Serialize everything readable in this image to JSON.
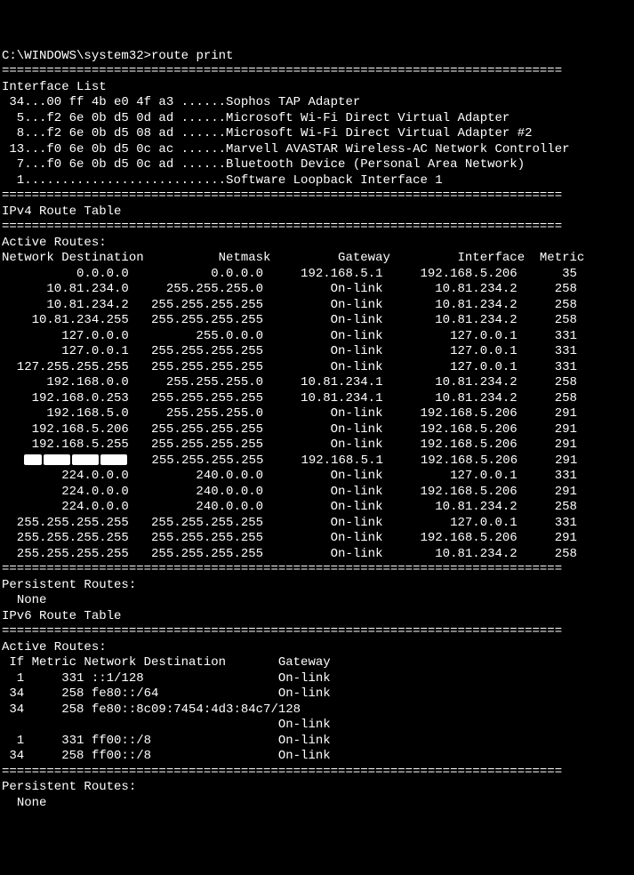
{
  "prompt": "C:\\WINDOWS\\system32>",
  "command": "route print",
  "divider": "===========================================================================",
  "interface_list": {
    "title": "Interface List",
    "items": [
      {
        "idx": "34",
        "mac": "00 ff 4b e0 4f a3",
        "desc": "Sophos TAP Adapter"
      },
      {
        "idx": "5",
        "mac": "f2 6e 0b d5 0d ad",
        "desc": "Microsoft Wi-Fi Direct Virtual Adapter"
      },
      {
        "idx": "8",
        "mac": "f2 6e 0b d5 08 ad",
        "desc": "Microsoft Wi-Fi Direct Virtual Adapter #2"
      },
      {
        "idx": "13",
        "mac": "f0 6e 0b d5 0c ac",
        "desc": "Marvell AVASTAR Wireless-AC Network Controller"
      },
      {
        "idx": "7",
        "mac": "f0 6e 0b d5 0c ad",
        "desc": "Bluetooth Device (Personal Area Network)"
      },
      {
        "idx": "1",
        "mac": "",
        "desc": "Software Loopback Interface 1"
      }
    ]
  },
  "ipv4": {
    "title": "IPv4 Route Table",
    "active_routes_label": "Active Routes:",
    "headers": [
      "Network Destination",
      "Netmask",
      "Gateway",
      "Interface",
      "Metric"
    ],
    "routes": [
      {
        "dest": "0.0.0.0",
        "mask": "0.0.0.0",
        "gw": "192.168.5.1",
        "iface": "192.168.5.206",
        "metric": "35"
      },
      {
        "dest": "10.81.234.0",
        "mask": "255.255.255.0",
        "gw": "On-link",
        "iface": "10.81.234.2",
        "metric": "258"
      },
      {
        "dest": "10.81.234.2",
        "mask": "255.255.255.255",
        "gw": "On-link",
        "iface": "10.81.234.2",
        "metric": "258"
      },
      {
        "dest": "10.81.234.255",
        "mask": "255.255.255.255",
        "gw": "On-link",
        "iface": "10.81.234.2",
        "metric": "258"
      },
      {
        "dest": "127.0.0.0",
        "mask": "255.0.0.0",
        "gw": "On-link",
        "iface": "127.0.0.1",
        "metric": "331"
      },
      {
        "dest": "127.0.0.1",
        "mask": "255.255.255.255",
        "gw": "On-link",
        "iface": "127.0.0.1",
        "metric": "331"
      },
      {
        "dest": "127.255.255.255",
        "mask": "255.255.255.255",
        "gw": "On-link",
        "iface": "127.0.0.1",
        "metric": "331"
      },
      {
        "dest": "192.168.0.0",
        "mask": "255.255.255.0",
        "gw": "10.81.234.1",
        "iface": "10.81.234.2",
        "metric": "258"
      },
      {
        "dest": "192.168.0.253",
        "mask": "255.255.255.255",
        "gw": "10.81.234.1",
        "iface": "10.81.234.2",
        "metric": "258"
      },
      {
        "dest": "192.168.5.0",
        "mask": "255.255.255.0",
        "gw": "On-link",
        "iface": "192.168.5.206",
        "metric": "291"
      },
      {
        "dest": "192.168.5.206",
        "mask": "255.255.255.255",
        "gw": "On-link",
        "iface": "192.168.5.206",
        "metric": "291"
      },
      {
        "dest": "192.168.5.255",
        "mask": "255.255.255.255",
        "gw": "On-link",
        "iface": "192.168.5.206",
        "metric": "291"
      },
      {
        "dest": "[REDACTED]",
        "mask": "255.255.255.255",
        "gw": "192.168.5.1",
        "iface": "192.168.5.206",
        "metric": "291",
        "redacted": true
      },
      {
        "dest": "224.0.0.0",
        "mask": "240.0.0.0",
        "gw": "On-link",
        "iface": "127.0.0.1",
        "metric": "331"
      },
      {
        "dest": "224.0.0.0",
        "mask": "240.0.0.0",
        "gw": "On-link",
        "iface": "192.168.5.206",
        "metric": "291"
      },
      {
        "dest": "224.0.0.0",
        "mask": "240.0.0.0",
        "gw": "On-link",
        "iface": "10.81.234.2",
        "metric": "258"
      },
      {
        "dest": "255.255.255.255",
        "mask": "255.255.255.255",
        "gw": "On-link",
        "iface": "127.0.0.1",
        "metric": "331"
      },
      {
        "dest": "255.255.255.255",
        "mask": "255.255.255.255",
        "gw": "On-link",
        "iface": "192.168.5.206",
        "metric": "291"
      },
      {
        "dest": "255.255.255.255",
        "mask": "255.255.255.255",
        "gw": "On-link",
        "iface": "10.81.234.2",
        "metric": "258"
      }
    ],
    "persistent_label": "Persistent Routes:",
    "persistent_value": "None"
  },
  "ipv6": {
    "title": "IPv6 Route Table",
    "active_routes_label": "Active Routes:",
    "headers": [
      "If",
      "Metric",
      "Network Destination",
      "Gateway"
    ],
    "routes": [
      {
        "if": "1",
        "metric": "331",
        "dest": "::1/128",
        "gw": "On-link"
      },
      {
        "if": "34",
        "metric": "258",
        "dest": "fe80::/64",
        "gw": "On-link"
      },
      {
        "if": "34",
        "metric": "258",
        "dest": "fe80::8c09:7454:4d3:84c7/128",
        "gw": "On-link",
        "wrap": true
      },
      {
        "if": "1",
        "metric": "331",
        "dest": "ff00::/8",
        "gw": "On-link"
      },
      {
        "if": "34",
        "metric": "258",
        "dest": "ff00::/8",
        "gw": "On-link"
      }
    ],
    "persistent_label": "Persistent Routes:",
    "persistent_value": "None"
  }
}
